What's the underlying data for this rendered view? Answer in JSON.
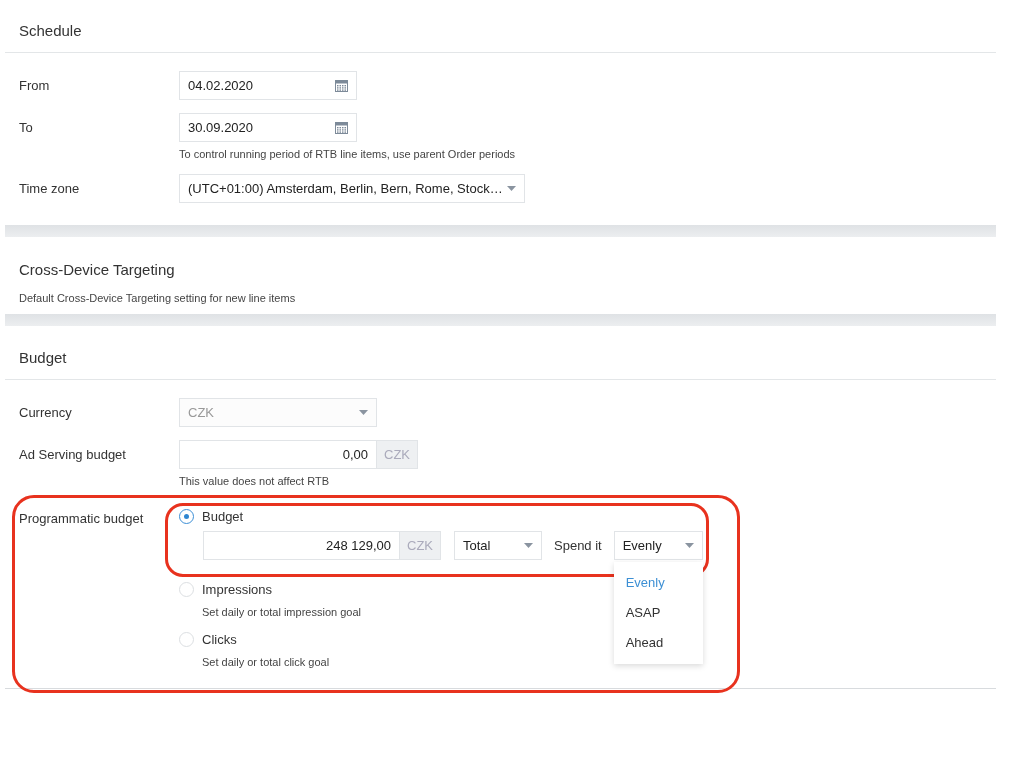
{
  "schedule": {
    "title": "Schedule",
    "fields": [
      {
        "kind": "date",
        "label": "From",
        "value": "04.02.2020"
      },
      {
        "kind": "date",
        "label": "To",
        "value": "30.09.2020",
        "hint": "To control running period of RTB line items, use parent Order periods"
      },
      {
        "kind": "select",
        "label": "Time zone",
        "value": "(UTC+01:00) Amsterdam, Berlin, Bern, Rome, Stock…"
      }
    ]
  },
  "cross_device": {
    "title": "Cross-Device Targeting",
    "description": "Default Cross-Device Targeting setting for new line items"
  },
  "budget": {
    "title": "Budget",
    "currency": {
      "label": "Currency",
      "value": "CZK",
      "disabled": true
    },
    "ad_serving": {
      "label": "Ad Serving budget",
      "value": "0,00",
      "unit": "CZK",
      "hint": "This value does not affect RTB"
    },
    "programmatic": {
      "label": "Programmatic budget",
      "highlighted": true,
      "options": [
        {
          "label": "Budget",
          "selected": true,
          "highlighted": true,
          "amount": "248 129,00",
          "unit": "CZK",
          "period": "Total",
          "spend_label": "Spend it",
          "spend": {
            "value": "Evenly",
            "expanded": true,
            "options": [
              {
                "label": "Evenly",
                "selected": true
              },
              {
                "label": "ASAP",
                "selected": false
              },
              {
                "label": "Ahead",
                "selected": false
              }
            ]
          }
        },
        {
          "label": "Impressions",
          "selected": false,
          "hint": "Set daily or total impression goal"
        },
        {
          "label": "Clicks",
          "selected": false,
          "hint": "Set daily or total click goal"
        }
      ]
    }
  }
}
